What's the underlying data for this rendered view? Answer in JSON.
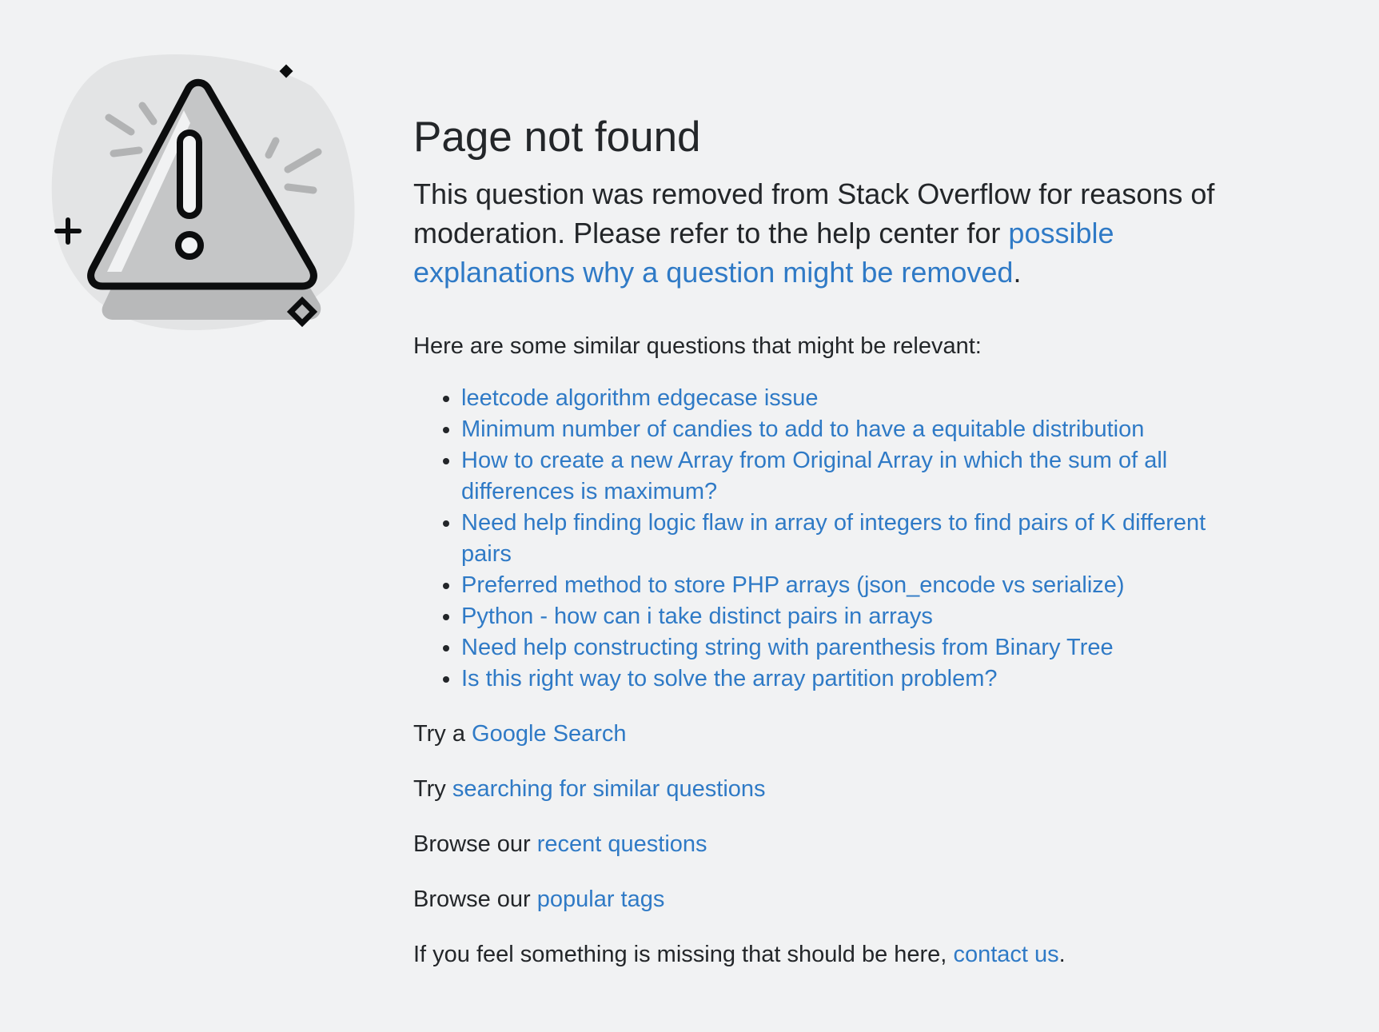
{
  "page": {
    "title": "Page not found",
    "lead": {
      "text_before": "This question was removed from Stack Overflow for reasons of moderation. Please refer to the help center for ",
      "link_text": "possible explanations why a question might be removed",
      "text_after": "."
    },
    "similar_intro": "Here are some similar questions that might be relevant:",
    "similar_questions": [
      "leetcode algorithm edgecase issue",
      "Minimum number of candies to add to have a equitable distribution",
      "How to create a new Array from Original Array in which the sum of all differences is maximum?",
      "Need help finding logic flaw in array of integers to find pairs of K different pairs",
      "Preferred method to store PHP arrays (json_encode vs serialize)",
      "Python - how can i take distinct pairs in arrays",
      "Need help constructing string with parenthesis from Binary Tree",
      "Is this right way to solve the array partition problem?"
    ],
    "actions": {
      "google": {
        "prefix": "Try a ",
        "link": "Google Search"
      },
      "search": {
        "prefix": "Try ",
        "link": "searching for similar questions"
      },
      "recent": {
        "prefix": "Browse our ",
        "link": "recent questions"
      },
      "tags": {
        "prefix": "Browse our ",
        "link": "popular tags"
      },
      "contact": {
        "prefix": "If you feel something is missing that should be here, ",
        "link": "contact us",
        "suffix": "."
      }
    }
  },
  "icons": {
    "illustration": "warning-triangle-icon"
  },
  "colors": {
    "background": "#f1f2f3",
    "text": "#232629",
    "link": "#2f7ac6",
    "blob": "#e3e4e5",
    "triangle_fill": "#c5c6c7",
    "icon_stroke": "#0c0d0e"
  }
}
